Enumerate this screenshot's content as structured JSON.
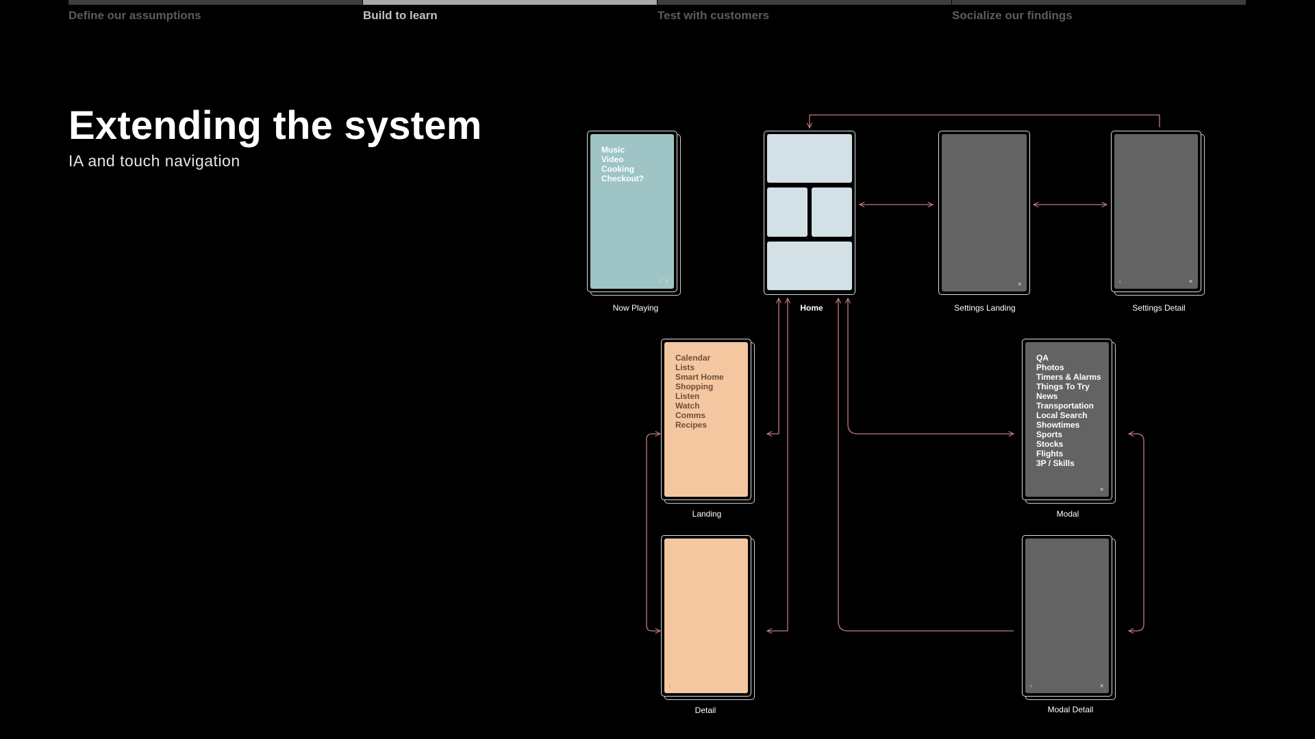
{
  "steps": [
    {
      "label": "Define our assumptions",
      "active": false
    },
    {
      "label": "Build to learn",
      "active": true
    },
    {
      "label": "Test with customers",
      "active": false
    },
    {
      "label": "Socialize our findings",
      "active": false
    }
  ],
  "heading": {
    "title": "Extending the system",
    "subtitle": "IA and touch navigation"
  },
  "colors": {
    "connector": "#c27c7c",
    "teal_screen": "#9ec4c6",
    "peach_screen": "#f4c7a1",
    "grey_screen": "#636363",
    "home_tile": "#d3e0e5"
  },
  "screens": {
    "now_playing": {
      "caption": "Now Playing",
      "items": [
        "Music",
        "Video",
        "Cooking",
        "Checkout?"
      ],
      "corner_glyph": "⤢ ✕"
    },
    "home": {
      "caption": "Home"
    },
    "settings_landing": {
      "caption": "Settings Landing",
      "close_glyph": "✕"
    },
    "settings_detail": {
      "caption": "Settings Detail",
      "back_glyph": "‹",
      "close_glyph": "✕"
    },
    "landing": {
      "caption": "Landing",
      "items": [
        "Calendar",
        "Lists",
        "Smart Home",
        "Shopping",
        "Listen",
        "Watch",
        "Comms",
        "Recipes"
      ]
    },
    "detail": {
      "caption": "Detail",
      "back_glyph": "‹"
    },
    "modal": {
      "caption": "Modal",
      "items": [
        "QA",
        "Photos",
        "Timers & Alarms",
        "Things To Try",
        "News",
        "Transportation",
        "Local Search",
        "Showtimes",
        "Sports",
        "Stocks",
        "Flights",
        "3P / Skills"
      ],
      "close_glyph": "✕"
    },
    "modal_detail": {
      "caption": "Modal Detail",
      "back_glyph": "‹",
      "close_glyph": "✕"
    }
  }
}
